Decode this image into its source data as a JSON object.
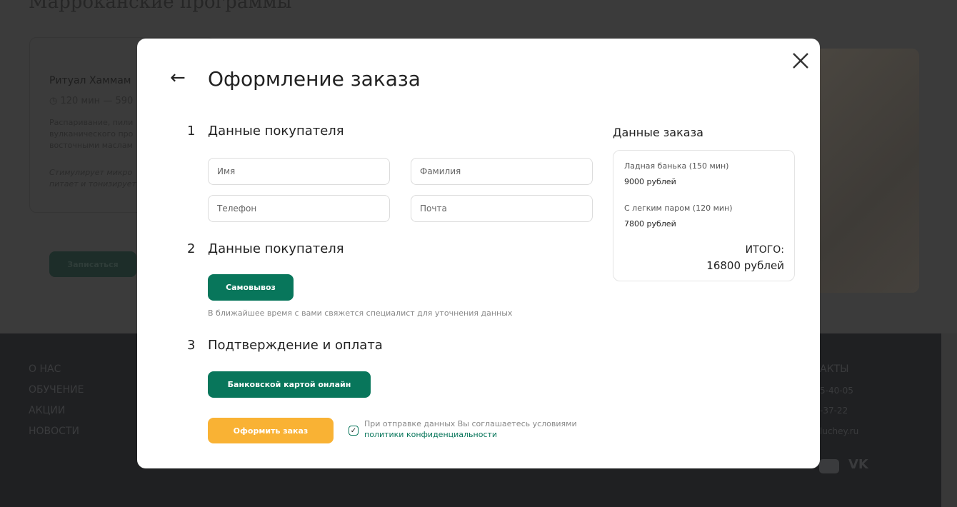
{
  "background": {
    "section_title": "Марроканские программы",
    "card": {
      "name": "Ритуал Хаммам",
      "time": "120 мин — 590",
      "description": [
        "Распаривание, пили",
        "вулканического про",
        "восточными маслам"
      ],
      "note": [
        "Стимулирует микро",
        "питает и тонизирует"
      ],
      "button": "Записаться"
    },
    "footer": {
      "links": [
        "О НАС",
        "ОБУЧЕНИЕ",
        "АКЦИИ",
        "НОВОСТИ"
      ],
      "contacts_title": "АКТЫ",
      "phones": [
        "5-40-05",
        "-37-22"
      ],
      "email": "luchey.ru"
    }
  },
  "modal": {
    "title": "Оформление заказа",
    "step1": {
      "number": "1",
      "title": "Данные покупателя",
      "placeholders": {
        "first_name": "Имя",
        "last_name": "Фамилия",
        "phone": "Телефон",
        "email": "Почта"
      }
    },
    "step2": {
      "number": "2",
      "title": "Данные покупателя",
      "button": "Самовывоз",
      "hint": "В ближайшее время с вами свяжется специалист для уточнения данных"
    },
    "step3": {
      "number": "3",
      "title": "Подтверждение и оплата",
      "button": "Банковской картой онлайн"
    },
    "submit": "Оформить заказ",
    "agreement": {
      "text": "При отправке данных Вы соглашаетесь условиями",
      "link": "политики конфиденциальности",
      "checked": true
    },
    "order": {
      "title": "Данные заказа",
      "items": [
        {
          "name": "Ладная банька (150 мин)",
          "price": "9000 рублей"
        },
        {
          "name": "С легким паром (120 мин)",
          "price": "7800 рублей"
        }
      ],
      "total_label": "ИТОГО:",
      "total": "16800 рублей"
    }
  },
  "colors": {
    "accent": "#08765b",
    "submit": "#f9b234"
  }
}
